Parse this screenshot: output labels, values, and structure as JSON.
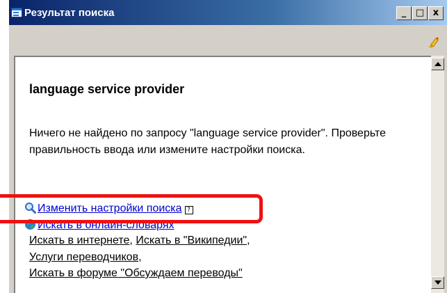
{
  "window": {
    "title": "Результат поиска",
    "minimize_glyph": "_",
    "maximize_glyph": "□",
    "close_glyph": "x"
  },
  "toolbar": {
    "marker_icon": "highlighter-icon"
  },
  "content": {
    "query_heading": "language service provider",
    "message": "Ничего не найдено по запросу \"language service provider\". Проверьте правильность ввода или измените настройки поиска.",
    "links": {
      "change_settings": "Изменить настройки поиска",
      "help_glyph": "?",
      "search_online_dictionaries": "Искать в онлайн-словарях",
      "search_internet": "Искать в интернете",
      "search_wikipedia": "Искать в \"Википедии\"",
      "translator_services": "Услуги переводчиков",
      "search_forum": "Искать в форуме \"Обсуждаем переводы\""
    },
    "separators": {
      "comma": ","
    }
  },
  "colors": {
    "title_gradient_start": "#0a246a",
    "title_gradient_end": "#a6caf0",
    "link_blue": "#0000cc",
    "highlight_red": "#ee1111",
    "window_face": "#d4d0c8"
  }
}
